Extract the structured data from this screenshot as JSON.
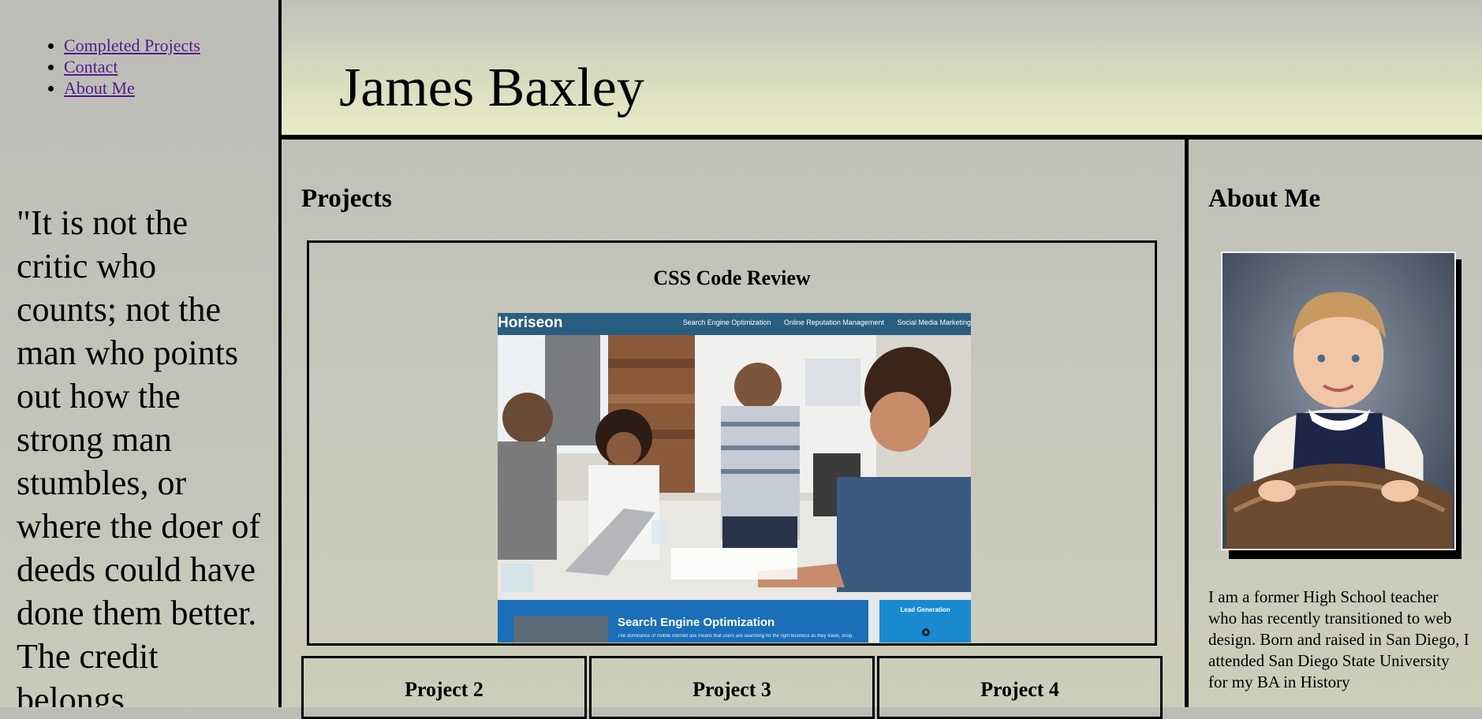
{
  "nav": {
    "items": [
      {
        "label": "Completed Projects"
      },
      {
        "label": "Contact"
      },
      {
        "label": "About Me"
      }
    ]
  },
  "sidebar": {
    "quote": "\"It is not the critic who counts; not the man who points out how the strong man stumbles, or where the doer of deeds could have done them better. The credit belongs"
  },
  "header": {
    "title": "James Baxley"
  },
  "projects": {
    "heading": "Projects",
    "featured": {
      "title": "CSS Code Review",
      "screenshot": {
        "logo": "Horiseon",
        "nav": [
          "Search Engine Optimization",
          "Online Reputation Management",
          "Social Media Marketing"
        ],
        "seo_title": "Search Engine Optimization",
        "seo_text": "The dominance of mobile internet use means that users are searching for the right business as they travel, shop,",
        "lead_title": "Lead Generation"
      }
    },
    "cards": [
      {
        "title": "Project 2"
      },
      {
        "title": "Project 3"
      },
      {
        "title": "Project 4"
      }
    ]
  },
  "about": {
    "heading": "About Me",
    "text": "I am a former High School teacher who has recently transitioned to web design. Born and raised in San Diego, I attended San Diego State University for my BA in History"
  }
}
